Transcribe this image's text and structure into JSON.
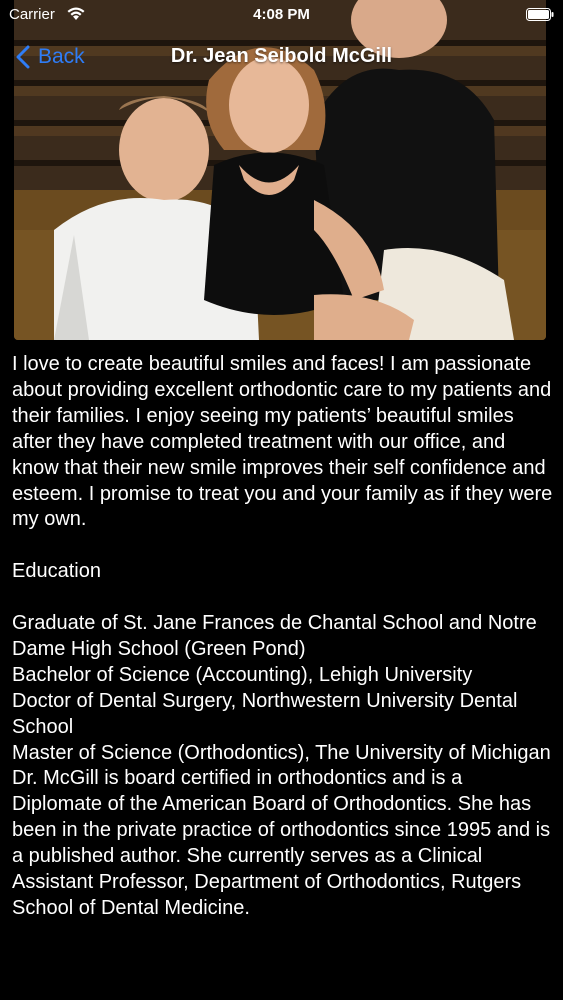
{
  "status_bar": {
    "carrier": "Carrier",
    "time": "4:08 PM",
    "icons": [
      "wifi-icon",
      "battery-icon"
    ]
  },
  "nav": {
    "back_label": "Back",
    "title": "Dr. Jean Seibold McGill",
    "accent_color": "#2f7df6"
  },
  "bio": {
    "intro": "I love to create beautiful smiles and faces! I am passionate about providing excellent orthodontic care to my patients and their families. I enjoy seeing my patients’ beautiful smiles after they have completed treatment with our office, and know that their new smile improves their self confidence and esteem. I promise to treat you and your family as if they were my own.",
    "education_heading": "Education",
    "education_items": [
      "Graduate of St. Jane Frances de Chantal School and Notre Dame High School (Green Pond)",
      "Bachelor of Science (Accounting), Lehigh University",
      "Doctor of Dental Surgery, Northwestern University Dental School",
      "Master of Science (Orthodontics), The University of Michigan",
      "Dr. McGill is board certified in orthodontics and is a Diplomate of the American Board of Orthodontics. She has been in the private practice of orthodontics since 1995 and is a published author. She currently serves as a Clinical Assistant Professor, Department of Orthodontics, Rutgers School of Dental Medicine."
    ]
  }
}
